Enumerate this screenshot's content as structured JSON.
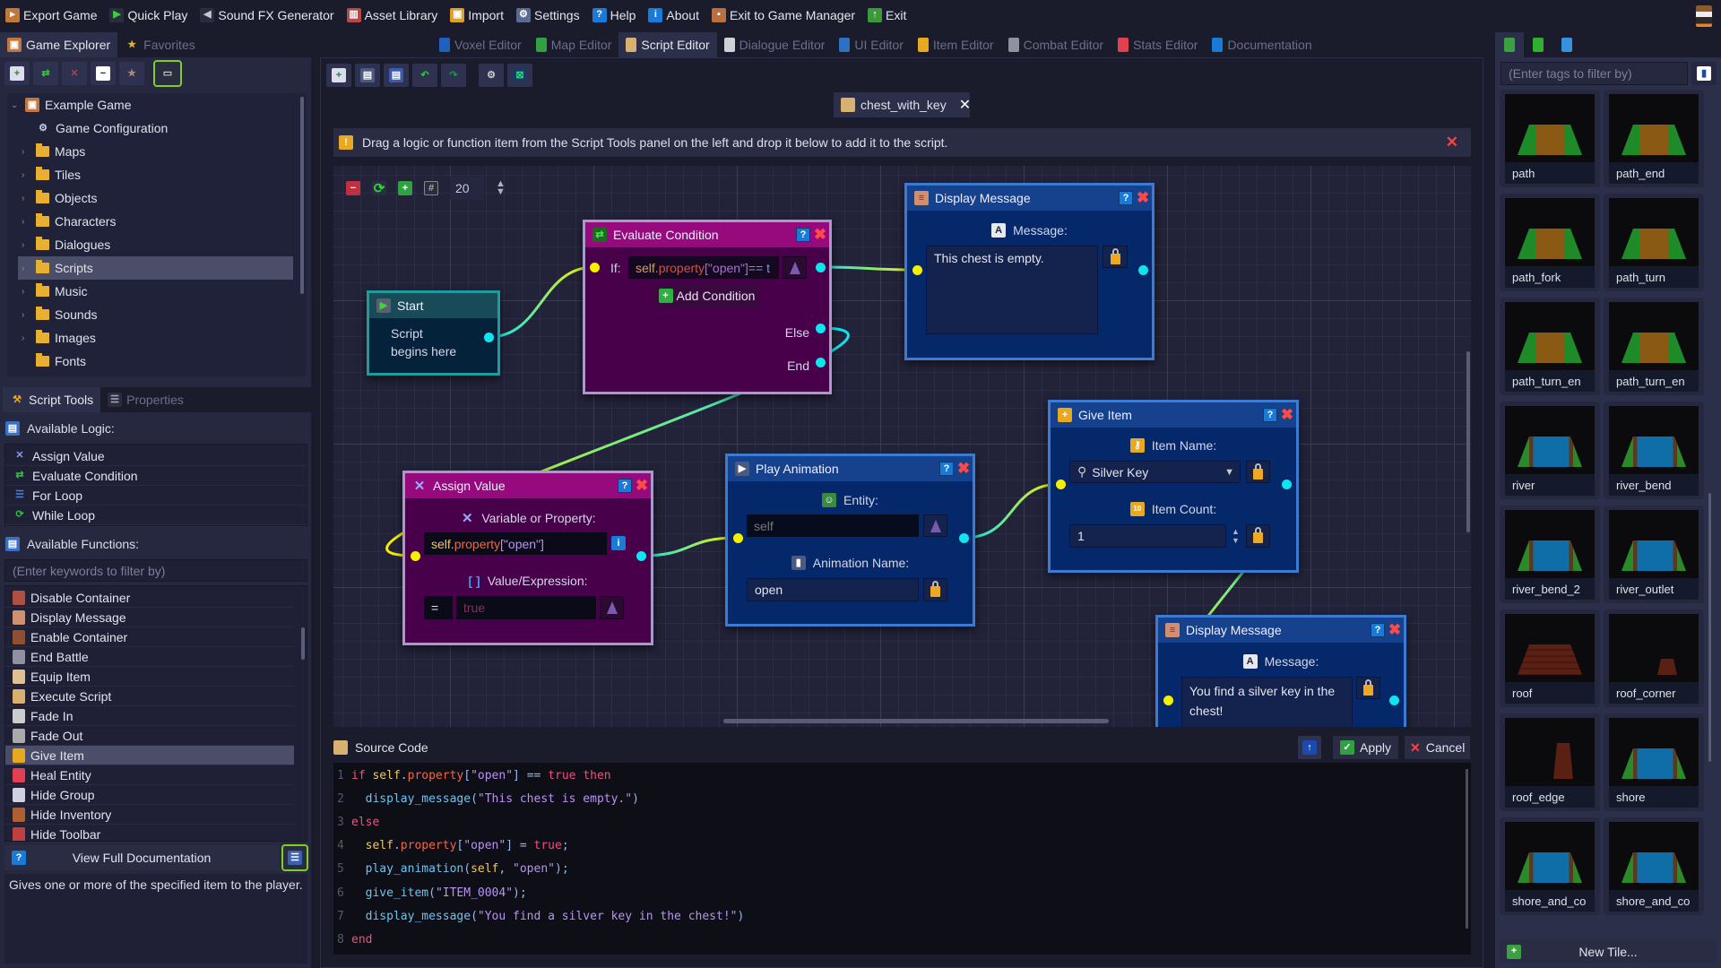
{
  "menu": [
    {
      "label": "Export Game",
      "icon": "export-game-icon",
      "glyph": "▸",
      "color": "#c0783a"
    },
    {
      "label": "Quick Play",
      "icon": "play-icon",
      "glyph": "▶",
      "color": "#2a2c40",
      "fg": "#3ccf3c"
    },
    {
      "label": "Sound FX Generator",
      "icon": "speaker-icon",
      "glyph": "◀",
      "color": "#2a2c40",
      "fg": "#c8c8d0"
    },
    {
      "label": "Asset Library",
      "icon": "asset-library-icon",
      "glyph": "▥",
      "color": "#b84848"
    },
    {
      "label": "Import",
      "icon": "import-icon",
      "glyph": "▣",
      "color": "#e0a020"
    },
    {
      "label": "Settings",
      "icon": "settings-icon",
      "glyph": "⚙",
      "color": "#5a6a90"
    },
    {
      "label": "Help",
      "icon": "help-icon",
      "glyph": "?",
      "color": "#1a7ad8"
    },
    {
      "label": "About",
      "icon": "about-icon",
      "glyph": "i",
      "color": "#1a7ad8"
    },
    {
      "label": "Exit to Game Manager",
      "icon": "game-manager-icon",
      "glyph": "▪",
      "color": "#b87040"
    },
    {
      "label": "Exit",
      "icon": "exit-icon",
      "glyph": "↑",
      "color": "#3a9a3a"
    }
  ],
  "left_tabs": [
    {
      "label": "Game Explorer",
      "icon": "game-explorer-icon",
      "active": true
    },
    {
      "label": "Favorites",
      "icon": "star-icon",
      "active": false
    }
  ],
  "editor_tabs": [
    {
      "label": "Voxel Editor",
      "icon": "voxel-icon",
      "color": "#2060c0",
      "active": false
    },
    {
      "label": "Map Editor",
      "icon": "map-icon",
      "color": "#30a040",
      "active": false
    },
    {
      "label": "Script Editor",
      "icon": "scroll-icon",
      "color": "#d8b070",
      "active": true
    },
    {
      "label": "Dialogue Editor",
      "icon": "dialogue-icon",
      "color": "#d0d0d8",
      "active": false
    },
    {
      "label": "UI Editor",
      "icon": "ui-icon",
      "color": "#3070c0",
      "active": false
    },
    {
      "label": "Item Editor",
      "icon": "key-icon",
      "color": "#e8a820",
      "active": false
    },
    {
      "label": "Combat Editor",
      "icon": "sword-icon",
      "color": "#9090a0",
      "active": false
    },
    {
      "label": "Stats Editor",
      "icon": "heart-icon",
      "color": "#e04050",
      "active": false
    },
    {
      "label": "Documentation",
      "icon": "documentation-icon",
      "color": "#1a7ad8",
      "active": false
    }
  ],
  "right_tabs": [
    {
      "icon": "tiles-icon",
      "color": "#3aa040",
      "active": true
    },
    {
      "icon": "tree-icon",
      "color": "#30b030",
      "active": false
    },
    {
      "icon": "character-icon",
      "color": "#3a90e0",
      "active": false
    }
  ],
  "explorer_toolbar": [
    "new-icon",
    "refresh-icon",
    "delete-icon",
    "collapse-icon",
    "favorite-icon",
    "link-icon"
  ],
  "tree": [
    {
      "label": "Example Game",
      "level": 0,
      "expanded": true,
      "icon": "game-icon"
    },
    {
      "label": "Game Configuration",
      "level": 1,
      "icon": "gear-icon"
    },
    {
      "label": "Maps",
      "level": 1,
      "icon": "folder-icon"
    },
    {
      "label": "Tiles",
      "level": 1,
      "icon": "folder-icon"
    },
    {
      "label": "Objects",
      "level": 1,
      "icon": "folder-icon"
    },
    {
      "label": "Characters",
      "level": 1,
      "icon": "folder-icon"
    },
    {
      "label": "Dialogues",
      "level": 1,
      "icon": "folder-icon"
    },
    {
      "label": "Scripts",
      "level": 1,
      "icon": "folder-icon",
      "selected": true
    },
    {
      "label": "Music",
      "level": 1,
      "icon": "folder-icon"
    },
    {
      "label": "Sounds",
      "level": 1,
      "icon": "folder-icon"
    },
    {
      "label": "Images",
      "level": 1,
      "icon": "folder-icon"
    },
    {
      "label": "Fonts",
      "level": 1,
      "icon": "folder-icon",
      "leaf": true
    }
  ],
  "tool_tabs": [
    {
      "label": "Script Tools",
      "active": true
    },
    {
      "label": "Properties",
      "active": false
    }
  ],
  "logic": {
    "header": "Available Logic:",
    "items": [
      {
        "label": "Assign Value",
        "glyph": "✕",
        "color": "#8a9cf0"
      },
      {
        "label": "Evaluate Condition",
        "glyph": "⇄",
        "color": "#30c040"
      },
      {
        "label": "For Loop",
        "glyph": "☰",
        "color": "#4a80e0"
      },
      {
        "label": "While Loop",
        "glyph": "⟳",
        "color": "#30c040"
      }
    ]
  },
  "functions": {
    "header": "Available Functions:",
    "filter_placeholder": "(Enter keywords to filter by)",
    "items": [
      {
        "label": "Disable Container",
        "color": "#b05040"
      },
      {
        "label": "Display Message",
        "color": "#d09070"
      },
      {
        "label": "Enable Container",
        "color": "#905030"
      },
      {
        "label": "End Battle",
        "color": "#9090a0"
      },
      {
        "label": "Equip Item",
        "color": "#e0c090"
      },
      {
        "label": "Execute Script",
        "color": "#d8b070"
      },
      {
        "label": "Fade In",
        "color": "#cccccc"
      },
      {
        "label": "Fade Out",
        "color": "#aaaaaa"
      },
      {
        "label": "Give Item",
        "color": "#e8a820",
        "selected": true
      },
      {
        "label": "Heal Entity",
        "color": "#e04050"
      },
      {
        "label": "Hide Group",
        "color": "#d0d0e0"
      },
      {
        "label": "Hide Inventory",
        "color": "#b06030"
      },
      {
        "label": "Hide Toolbar",
        "color": "#c04040"
      }
    ]
  },
  "docs_button": "View Full Documentation",
  "description": "Gives one or more of the specified item to the player.",
  "script_toolbar": [
    "new-script-icon",
    "save-icon",
    "save-as-icon",
    "undo-icon",
    "redo-icon",
    "settings-icon",
    "export-icon"
  ],
  "file_tab": {
    "label": "chest_with_key"
  },
  "info_bar": {
    "text": "Drag a logic or function item from the Script Tools panel on the left and drop it below to add it to the script."
  },
  "canvas_toolbar": {
    "grid_snap": "20"
  },
  "nodes": {
    "start": {
      "title": "Start",
      "text": "Script begins here"
    },
    "evaluate": {
      "title": "Evaluate Condition",
      "if_label": "If:",
      "condition_tokens": [
        [
          "self",
          "self"
        ],
        [
          ".",
          "punct"
        ],
        [
          "property",
          "prop"
        ],
        [
          "[\"open\"]",
          "str"
        ],
        [
          " == t",
          "op"
        ]
      ],
      "add_condition": "Add Condition",
      "else_label": "Else",
      "end_label": "End"
    },
    "display1": {
      "title": "Display Message",
      "message_label": "Message:",
      "message": "This chest is empty."
    },
    "give": {
      "title": "Give Item",
      "item_name_label": "Item Name:",
      "item_name": "Silver Key",
      "item_count_label": "Item Count:",
      "item_count": "1"
    },
    "assign": {
      "title": "Assign Value",
      "variable_label": "Variable or Property:",
      "variable_tokens": [
        [
          "self",
          "self"
        ],
        [
          ".",
          "punct"
        ],
        [
          "property",
          "prop"
        ],
        [
          "[\"open\"]",
          "str"
        ]
      ],
      "value_label": "Value/Expression:",
      "operator": "=",
      "value_placeholder": "true"
    },
    "play": {
      "title": "Play Animation",
      "entity_label": "Entity:",
      "entity_placeholder": "self",
      "animation_label": "Animation Name:",
      "animation": "open"
    },
    "display2": {
      "title": "Display Message",
      "message_label": "Message:",
      "message": "You find a silver key in the chest!"
    }
  },
  "connections": [
    {
      "from": "start.out",
      "to": "evaluate.in"
    },
    {
      "from": "evaluate.if",
      "to": "display1.in"
    },
    {
      "from": "evaluate.else",
      "to": "assign.in"
    },
    {
      "from": "assign.out",
      "to": "play.in"
    },
    {
      "from": "play.out",
      "to": "give.in"
    },
    {
      "from": "give.out",
      "to": "display2.in"
    }
  ],
  "connection_colors": {
    "out": "#10e4f0",
    "in": "#f4f000"
  },
  "source": {
    "title": "Source Code",
    "apply": "Apply",
    "cancel": "Cancel",
    "lines": [
      [
        [
          "if ",
          "kw"
        ],
        [
          "self",
          "self"
        ],
        [
          ".",
          "punct"
        ],
        [
          "property",
          "prop"
        ],
        [
          "[",
          "punct"
        ],
        [
          "\"open\"",
          "str"
        ],
        [
          "]",
          "punct"
        ],
        [
          " == ",
          "op"
        ],
        [
          "true",
          "kw2"
        ],
        [
          " then",
          "kw"
        ]
      ],
      [
        [
          "  ",
          "sp"
        ],
        [
          "display_message",
          "fn"
        ],
        [
          "(",
          "punct"
        ],
        [
          "\"This chest is empty.\"",
          "str"
        ],
        [
          ")",
          "punct"
        ]
      ],
      [
        [
          "else",
          "kw"
        ]
      ],
      [
        [
          "  ",
          "sp"
        ],
        [
          "self",
          "self"
        ],
        [
          ".",
          "punct"
        ],
        [
          "property",
          "prop"
        ],
        [
          "[",
          "punct"
        ],
        [
          "\"open\"",
          "str"
        ],
        [
          "]",
          "punct"
        ],
        [
          " = ",
          "op"
        ],
        [
          "true",
          "kw2"
        ],
        [
          ";",
          "punct"
        ]
      ],
      [
        [
          "  ",
          "sp"
        ],
        [
          "play_animation",
          "fn"
        ],
        [
          "(",
          "punct"
        ],
        [
          "self",
          "self"
        ],
        [
          ", ",
          "punct"
        ],
        [
          "\"open\"",
          "str"
        ],
        [
          ");",
          "punct"
        ]
      ],
      [
        [
          "  ",
          "sp"
        ],
        [
          "give_item",
          "fn"
        ],
        [
          "(",
          "punct"
        ],
        [
          "\"ITEM_0004\"",
          "str"
        ],
        [
          ");",
          "punct"
        ]
      ],
      [
        [
          "  ",
          "sp"
        ],
        [
          "display_message",
          "fn"
        ],
        [
          "(",
          "punct"
        ],
        [
          "\"You find a silver key in the chest!\"",
          "str"
        ],
        [
          ")",
          "punct"
        ]
      ],
      [
        [
          "end",
          "kw"
        ]
      ]
    ]
  },
  "tiles": {
    "filter_placeholder": "(Enter tags to filter by)",
    "items": [
      {
        "label": "path",
        "kind": "path"
      },
      {
        "label": "path_end",
        "kind": "path"
      },
      {
        "label": "path_fork",
        "kind": "path"
      },
      {
        "label": "path_turn",
        "kind": "path"
      },
      {
        "label": "path_turn_en",
        "kind": "path"
      },
      {
        "label": "path_turn_en",
        "kind": "path"
      },
      {
        "label": "river",
        "kind": "river"
      },
      {
        "label": "river_bend",
        "kind": "river"
      },
      {
        "label": "river_bend_2",
        "kind": "river"
      },
      {
        "label": "river_outlet",
        "kind": "river"
      },
      {
        "label": "roof",
        "kind": "roof"
      },
      {
        "label": "roof_corner",
        "kind": "roof-small"
      },
      {
        "label": "roof_edge",
        "kind": "roof-small"
      },
      {
        "label": "shore",
        "kind": "river"
      },
      {
        "label": "shore_and_co",
        "kind": "river"
      },
      {
        "label": "shore_and_co",
        "kind": "river"
      }
    ],
    "new_tile": "New Tile..."
  }
}
